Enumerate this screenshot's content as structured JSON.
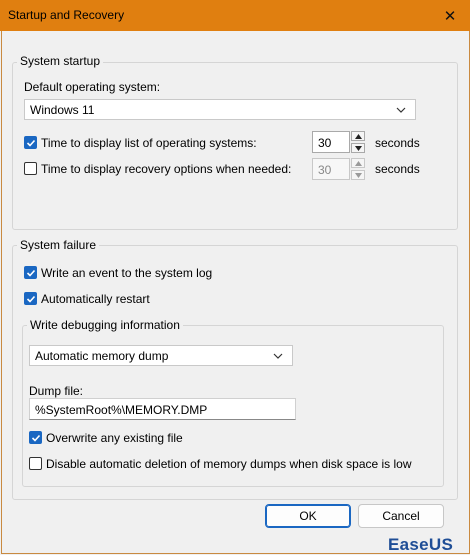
{
  "window": {
    "title": "Startup and Recovery",
    "close_glyph": "✕"
  },
  "system_startup": {
    "legend": "System startup",
    "default_os_label": "Default operating system:",
    "default_os_value": "Windows 11",
    "show_os_list": {
      "label": "Time to display list of operating systems:",
      "checked": true,
      "value": "30",
      "unit": "seconds"
    },
    "show_recovery": {
      "label": "Time to display recovery options when needed:",
      "checked": false,
      "value": "30",
      "unit": "seconds"
    }
  },
  "system_failure": {
    "legend": "System failure",
    "write_event": {
      "label": "Write an event to the system log",
      "checked": true
    },
    "auto_restart": {
      "label": "Automatically restart",
      "checked": true
    },
    "debug": {
      "legend": "Write debugging information",
      "dump_type": "Automatic memory dump",
      "dump_file_label": "Dump file:",
      "dump_file_value": "%SystemRoot%\\MEMORY.DMP",
      "overwrite": {
        "label": "Overwrite any existing file",
        "checked": true
      },
      "disable_auto_delete": {
        "label": "Disable automatic deletion of memory dumps when disk space is low",
        "checked": false
      }
    }
  },
  "buttons": {
    "ok": "OK",
    "cancel": "Cancel"
  },
  "watermark": {
    "text": "EaseUS"
  },
  "colors": {
    "titlebar": "#e07f10",
    "accent": "#1a67c2",
    "brand": "#1f4e96"
  },
  "icons": {
    "close": "close-icon",
    "dropdown": "chevron-down-icon",
    "check": "checkmark-icon",
    "spin_up": "arrow-up-icon",
    "spin_down": "arrow-down-icon",
    "logo": "easeus-logo-icon"
  }
}
